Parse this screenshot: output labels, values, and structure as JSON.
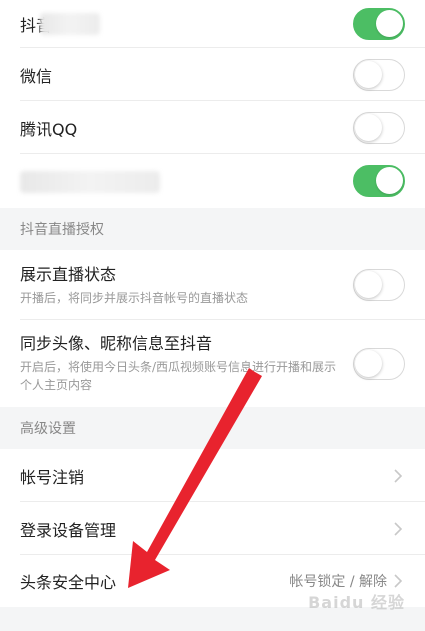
{
  "share": {
    "items": [
      {
        "label": "抖音",
        "on": true
      },
      {
        "label": "微信",
        "on": false
      },
      {
        "label": "腾讯QQ",
        "on": false
      },
      {
        "label": "",
        "on": true
      }
    ]
  },
  "live": {
    "header": "抖音直播授权",
    "items": [
      {
        "title": "展示直播状态",
        "sub": "开播后，将同步并展示抖音帐号的直播状态",
        "on": false
      },
      {
        "title": "同步头像、昵称信息至抖音",
        "sub": "开启后，将使用今日头条/西瓜视频账号信息进行开播和展示个人主页内容",
        "on": false
      }
    ]
  },
  "advanced": {
    "header": "高级设置",
    "items": [
      {
        "label": "帐号注销",
        "value": ""
      },
      {
        "label": "登录设备管理",
        "value": ""
      },
      {
        "label": "头条安全中心",
        "value": "帐号锁定 / 解除"
      }
    ]
  },
  "watermark": "Baidu 经验",
  "colors": {
    "toggle_on": "#4cbe64",
    "arrow": "#e8232e",
    "page_bg": "#f4f5f6"
  },
  "icons": {
    "chevron": "chevron-right-icon"
  }
}
